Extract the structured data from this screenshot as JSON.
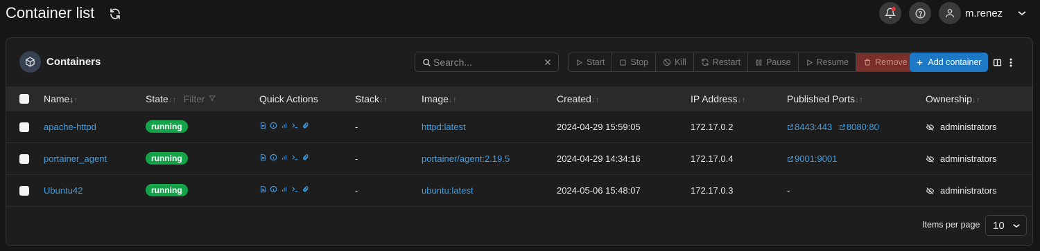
{
  "header": {
    "title": "Container list",
    "username": "m.renez"
  },
  "panel": {
    "title": "Containers",
    "search_placeholder": "Search...",
    "actions": [
      "Start",
      "Stop",
      "Kill",
      "Restart",
      "Pause",
      "Resume",
      "Remove"
    ],
    "add_label": "Add container"
  },
  "table": {
    "columns": {
      "name": "Name",
      "state": "State",
      "filter": "Filter",
      "quick_actions": "Quick Actions",
      "stack": "Stack",
      "image": "Image",
      "created": "Created",
      "ip": "IP Address",
      "ports": "Published Ports",
      "ownership": "Ownership"
    },
    "rows": [
      {
        "name": "apache-httpd",
        "state": "running",
        "stack": "-",
        "image": "httpd:latest",
        "created": "2024-04-29 15:59:05",
        "ip": "172.17.0.2",
        "ports": [
          "8443:443",
          "8080:80"
        ],
        "ownership": "administrators"
      },
      {
        "name": "portainer_agent",
        "state": "running",
        "stack": "-",
        "image": "portainer/agent:2.19.5",
        "created": "2024-04-29 14:34:16",
        "ip": "172.17.0.4",
        "ports": [
          "9001:9001"
        ],
        "ownership": "administrators"
      },
      {
        "name": "Ubuntu42",
        "state": "running",
        "stack": "-",
        "image": "ubuntu:latest",
        "created": "2024-05-06 15:48:07",
        "ip": "172.17.0.3",
        "ports": [],
        "ports_empty": "-",
        "ownership": "administrators"
      }
    ]
  },
  "footer": {
    "items_per_page_label": "Items per page",
    "items_per_page_value": "10"
  },
  "colors": {
    "accent": "#1d78c6",
    "running": "#15a34a",
    "link": "#3b9ce0",
    "remove": "#7a2f2a"
  }
}
